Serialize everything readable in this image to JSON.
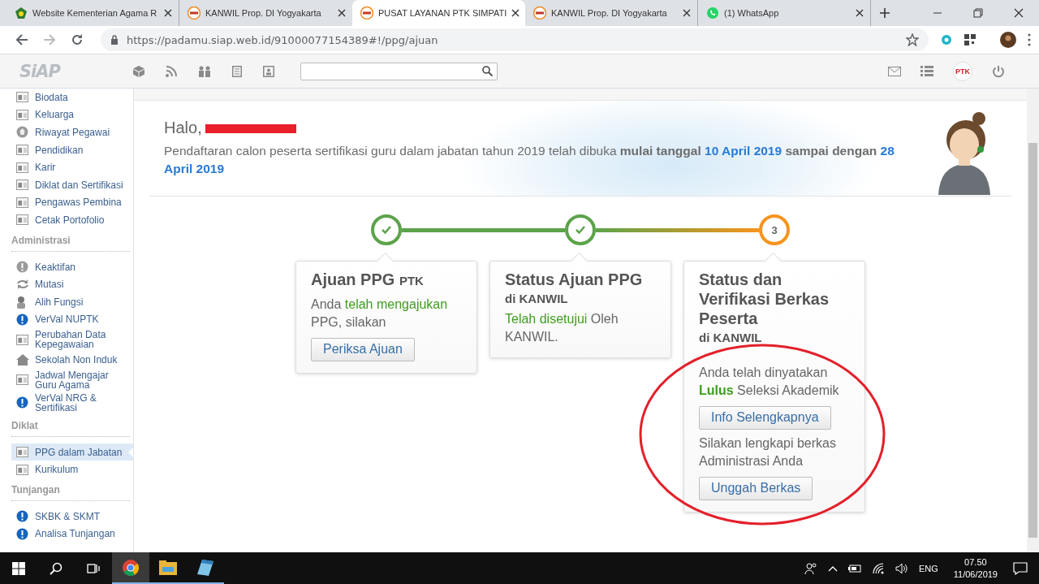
{
  "browser": {
    "tabs": [
      {
        "title": "Website Kementerian Agama R",
        "kind": "emblem",
        "selected": false
      },
      {
        "title": "KANWIL Prop. DI Yogyakarta",
        "kind": "siap",
        "selected": false
      },
      {
        "title": "PUSAT LAYANAN PTK SIMPATI",
        "kind": "siap",
        "selected": true
      },
      {
        "title": "KANWIL Prop. DI Yogyakarta",
        "kind": "siap",
        "selected": false
      },
      {
        "title": "(1) WhatsApp",
        "kind": "whatsapp",
        "selected": false
      }
    ],
    "url": "https://padamu.siap.web.id/91000077154389#!/ppg/ajuan"
  },
  "app": {
    "logo": "SiAP",
    "profile_badge": "PTK"
  },
  "sidebar": {
    "groups": [
      {
        "items": [
          {
            "label": "Biodata",
            "kind": "card",
            "selected": false
          },
          {
            "label": "Keluarga",
            "kind": "card",
            "selected": false
          },
          {
            "label": "Riwayat Pegawai",
            "kind": "badge",
            "selected": false
          },
          {
            "label": "Pendidikan",
            "kind": "card",
            "selected": false
          },
          {
            "label": "Karir",
            "kind": "card",
            "selected": false
          },
          {
            "label": "Diklat dan Sertifikasi",
            "kind": "card",
            "selected": false
          },
          {
            "label": "Pengawas Pembina",
            "kind": "card",
            "selected": false
          },
          {
            "label": "Cetak Portofolio",
            "kind": "card",
            "selected": false
          }
        ]
      },
      {
        "heading": "Administrasi",
        "items": [
          {
            "label": "Keaktifan",
            "kind": "info",
            "selected": false
          },
          {
            "label": "Mutasi",
            "kind": "sync",
            "selected": false
          },
          {
            "label": "Alih Fungsi",
            "kind": "person",
            "selected": false
          },
          {
            "label": "VerVal NUPTK",
            "kind": "alert",
            "selected": false
          },
          {
            "label": "Perubahan Data Kepegawaian",
            "kind": "card",
            "selected": false
          },
          {
            "label": "Sekolah Non Induk",
            "kind": "home",
            "selected": false
          },
          {
            "label": "Jadwal Mengajar Guru Agama",
            "kind": "card",
            "selected": false
          },
          {
            "label": "VerVal NRG & Sertifikasi",
            "kind": "alert",
            "selected": false
          }
        ]
      },
      {
        "heading": "Diklat",
        "items": [
          {
            "label": "PPG dalam Jabatan",
            "kind": "card",
            "selected": true
          },
          {
            "label": "Kurikulum",
            "kind": "card",
            "selected": false
          }
        ]
      },
      {
        "heading": "Tunjangan",
        "items": [
          {
            "label": "SKBK & SKMT",
            "kind": "alert",
            "selected": false
          },
          {
            "label": "Analisa Tunjangan",
            "kind": "alert",
            "selected": false
          }
        ]
      }
    ]
  },
  "greeting": {
    "salutation": "Halo,",
    "redacted": true,
    "message": [
      {
        "text": "Pendaftaran calon peserta sertifikasi guru dalam jabatan tahun 2019 telah dibuka ",
        "kind": "plain"
      },
      {
        "text": "mulai tanggal ",
        "kind": "bold"
      },
      {
        "text": "10 April 2019",
        "kind": "date"
      },
      {
        "text": " sampai dengan ",
        "kind": "bold"
      },
      {
        "text": "28 April 2019",
        "kind": "date"
      }
    ]
  },
  "steps": [
    {
      "done": true
    },
    {
      "done": true
    },
    {
      "done": false,
      "number": "3"
    }
  ],
  "cards": [
    {
      "title": "Ajuan PPG",
      "title_suffix": "PTK",
      "blocks": [
        {
          "kind": "text",
          "parts": [
            {
              "text": "Anda ",
              "kind": "plain"
            },
            {
              "text": "telah mengajukan",
              "kind": "success"
            },
            {
              "text": " PPG, silakan",
              "kind": "plain"
            }
          ]
        },
        {
          "kind": "button",
          "label": "Periksa Ajuan"
        }
      ]
    },
    {
      "title": "Status Ajuan PPG",
      "subtitle": "di KANWIL",
      "blocks": [
        {
          "kind": "text",
          "parts": [
            {
              "text": "Telah disetujui",
              "kind": "success"
            },
            {
              "text": " Oleh KANWIL.",
              "kind": "plain"
            }
          ]
        }
      ]
    },
    {
      "title": "Status dan Verifikasi Berkas Peserta",
      "subtitle": "di KANWIL",
      "blocks": [
        {
          "kind": "text",
          "parts": [
            {
              "text": "Anda telah dinyatakan ",
              "kind": "plain"
            },
            {
              "text": "Lulus",
              "kind": "success-bold"
            },
            {
              "text": " Seleksi Akademik",
              "kind": "plain"
            }
          ]
        },
        {
          "kind": "button",
          "label": "Info Selengkapnya"
        },
        {
          "kind": "text",
          "parts": [
            {
              "text": "Silakan lengkapi berkas Administrasi Anda",
              "kind": "plain"
            }
          ]
        },
        {
          "kind": "button",
          "label": "Unggah Berkas"
        }
      ]
    }
  ],
  "taskbar": {
    "apps": [
      {
        "kind": "chrome",
        "selected": true,
        "running": true
      },
      {
        "kind": "folder",
        "selected": false,
        "running": true
      },
      {
        "kind": "notepad",
        "selected": false,
        "running": true
      }
    ],
    "language": "ENG",
    "time": "07.50",
    "date": "11/06/2019"
  }
}
